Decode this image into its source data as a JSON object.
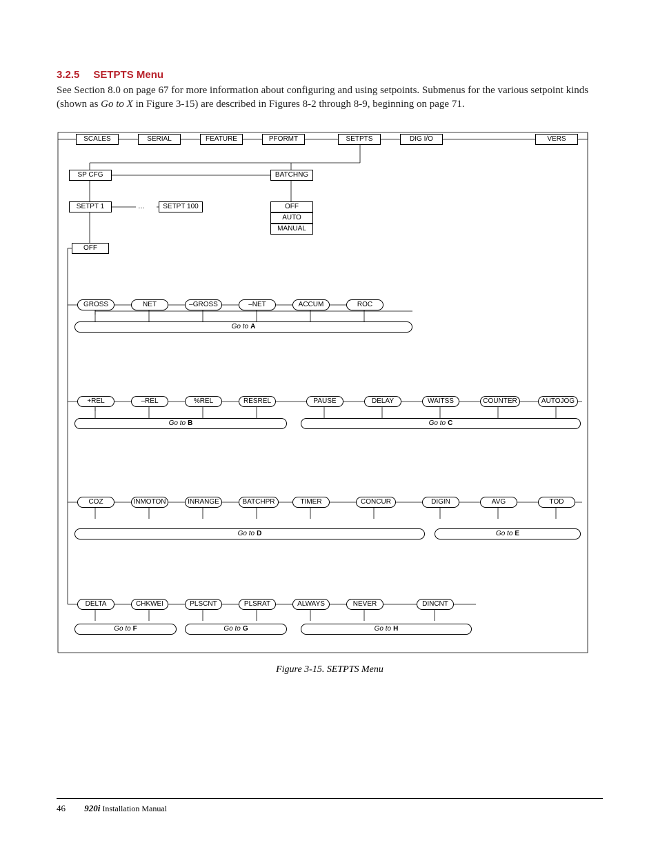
{
  "heading": {
    "num": "3.2.5",
    "title": "SETPTS Menu"
  },
  "paragraph": "See Section 8.0 on page 67 for more information about configuring and using setpoints. Submenus for the various setpoint kinds (shown as ",
  "goto_x": "Go to X",
  "paragraph2": " in Figure 3-15) are described in Figures 8-2 through 8-9, beginning on page 71.",
  "topmenu": [
    "SCALES",
    "SERIAL",
    "FEATURE",
    "PFORMT",
    "SETPTS",
    "DIG I/O",
    "VERS"
  ],
  "level2": {
    "spcfg": "SP CFG",
    "batchng": "BATCHNG"
  },
  "setpts": {
    "s1": "SETPT 1",
    "dots": "…",
    "s100": "SETPT 100"
  },
  "batchopts": [
    "OFF",
    "AUTO",
    "MANUAL"
  ],
  "off": "OFF",
  "rowA": [
    "GROSS",
    "NET",
    "–GROSS",
    "–NET",
    "ACCUM",
    "ROC"
  ],
  "gotoA": {
    "pre": "Go to ",
    "l": "A"
  },
  "rowB": [
    "+REL",
    "–REL",
    "%REL",
    "RESREL"
  ],
  "rowC": [
    "PAUSE",
    "DELAY",
    "WAITSS",
    "COUNTER",
    "AUTOJOG"
  ],
  "gotoB": {
    "pre": "Go to ",
    "l": "B"
  },
  "gotoC": {
    "pre": "Go to ",
    "l": "C"
  },
  "rowD": [
    "COZ",
    "INMOTON",
    "INRANGE",
    "BATCHPR",
    "TIMER",
    "CONCUR"
  ],
  "rowE": [
    "DIGIN",
    "AVG",
    "TOD"
  ],
  "gotoD": {
    "pre": "Go to ",
    "l": "D"
  },
  "gotoE": {
    "pre": "Go to ",
    "l": "E"
  },
  "rowF": [
    "DELTA",
    "CHKWEI"
  ],
  "rowG": [
    "PLSCNT",
    "PLSRAT"
  ],
  "rowH": [
    "ALWAYS",
    "NEVER",
    "DINCNT"
  ],
  "gotoF": {
    "pre": "Go to ",
    "l": "F"
  },
  "gotoG": {
    "pre": "Go to ",
    "l": "G"
  },
  "gotoH": {
    "pre": "Go to ",
    "l": "H"
  },
  "caption": "Figure 3-15. SETPTS Menu",
  "footer": {
    "page": "46",
    "book_italic": "920i",
    "book_rest": " Installation Manual"
  }
}
